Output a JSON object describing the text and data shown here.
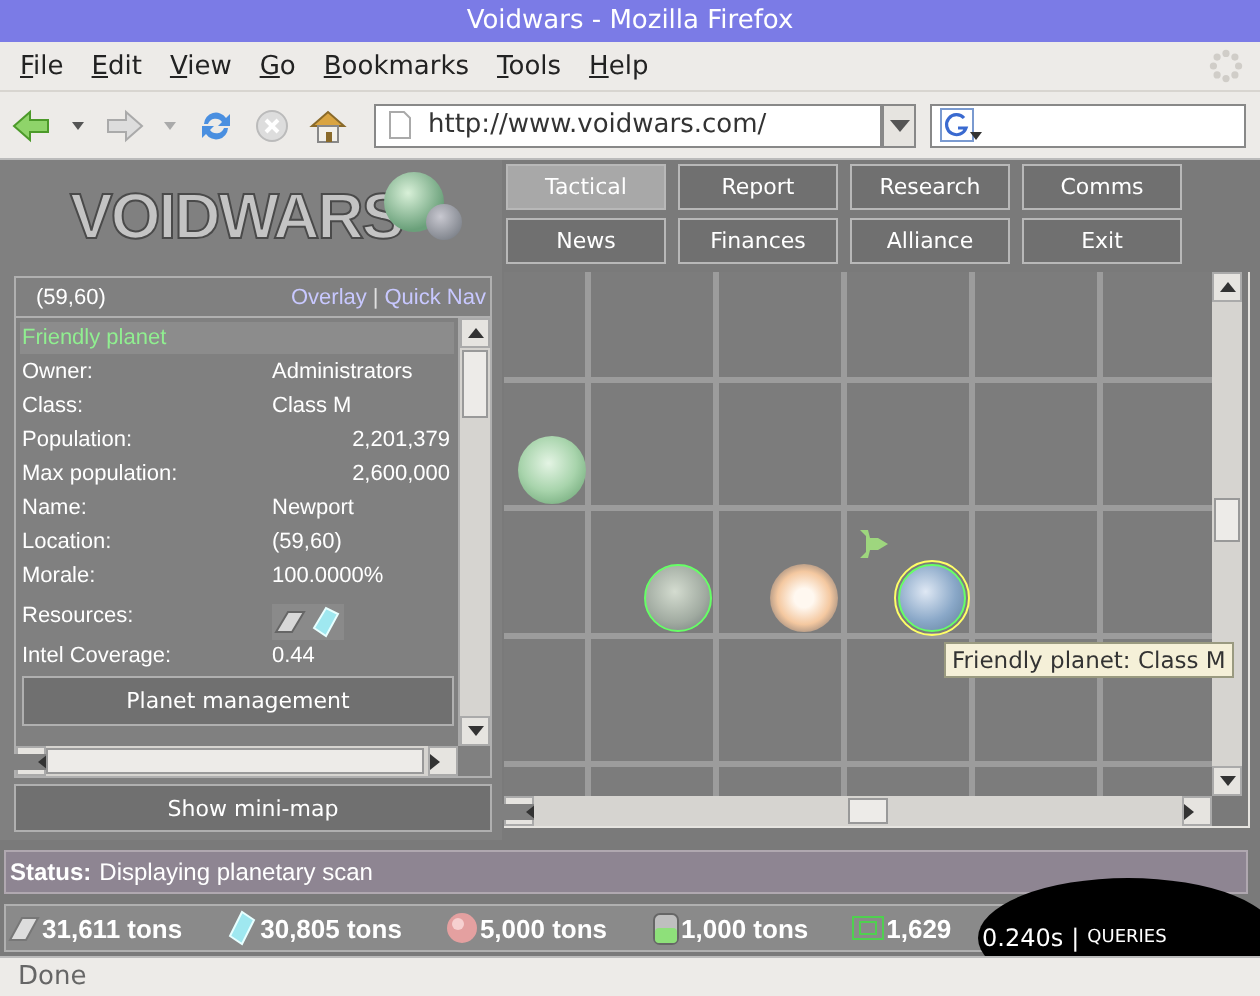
{
  "window": {
    "title": "Voidwars - Mozilla Firefox"
  },
  "menu": [
    "File",
    "Edit",
    "View",
    "Go",
    "Bookmarks",
    "Tools",
    "Help"
  ],
  "address": {
    "value": "http://www.voidwars.com/"
  },
  "logo": {
    "text": "VOIDWARS"
  },
  "nav_buttons": [
    {
      "label": "Tactical",
      "selected": true
    },
    {
      "label": "Report",
      "selected": false
    },
    {
      "label": "Research",
      "selected": false
    },
    {
      "label": "Comms",
      "selected": false
    },
    {
      "label": "News",
      "selected": false
    },
    {
      "label": "Finances",
      "selected": false
    },
    {
      "label": "Alliance",
      "selected": false
    },
    {
      "label": "Exit",
      "selected": false
    }
  ],
  "coords_bar": {
    "coords": "(59,60)",
    "links": [
      "Overlay",
      "Quick Nav"
    ],
    "separator": "|"
  },
  "planet_info": {
    "heading": "Friendly planet",
    "rows": [
      {
        "kind": "text",
        "label": "Owner:",
        "value": "Administrators"
      },
      {
        "kind": "text",
        "label": "Class:",
        "value": "Class M"
      },
      {
        "kind": "number",
        "label": "Population:",
        "value": "2,201,379"
      },
      {
        "kind": "number",
        "label": "Max population:",
        "value": "2,600,000"
      },
      {
        "kind": "text",
        "label": "Name:",
        "value": "Newport"
      },
      {
        "kind": "text",
        "label": "Location:",
        "value": "(59,60)"
      },
      {
        "kind": "text",
        "label": "Morale:",
        "value": "100.0000%"
      },
      {
        "kind": "icons",
        "label": "Resources:"
      },
      {
        "kind": "text",
        "label": "Intel Coverage:",
        "value": "0.44"
      }
    ],
    "button": "Planet management"
  },
  "minimap_button": "Show mini-map",
  "map": {
    "objects": [
      {
        "kind": "gas-planet",
        "friendly": false,
        "selected": false
      },
      {
        "kind": "moon",
        "friendly": true,
        "selected": false
      },
      {
        "kind": "star",
        "friendly": false,
        "selected": false
      },
      {
        "kind": "ship",
        "friendly": false,
        "selected": false
      },
      {
        "kind": "earth-planet",
        "friendly": true,
        "selected": true
      }
    ],
    "tooltip": "Friendly planet: Class M"
  },
  "status": {
    "label": "Status:",
    "text": "Displaying planetary scan"
  },
  "resources": [
    {
      "kind": "ingot",
      "amount": "31,611 tons"
    },
    {
      "kind": "crystal",
      "amount": "30,805 tons"
    },
    {
      "kind": "sphere",
      "amount": "5,000 tons"
    },
    {
      "kind": "canister",
      "amount": "1,000 tons"
    },
    {
      "kind": "cash",
      "amount": "1,629"
    }
  ],
  "query_overlay": {
    "time": "0.240s",
    "separator": "|",
    "label": "QUERIES"
  },
  "status_bar": "Done"
}
